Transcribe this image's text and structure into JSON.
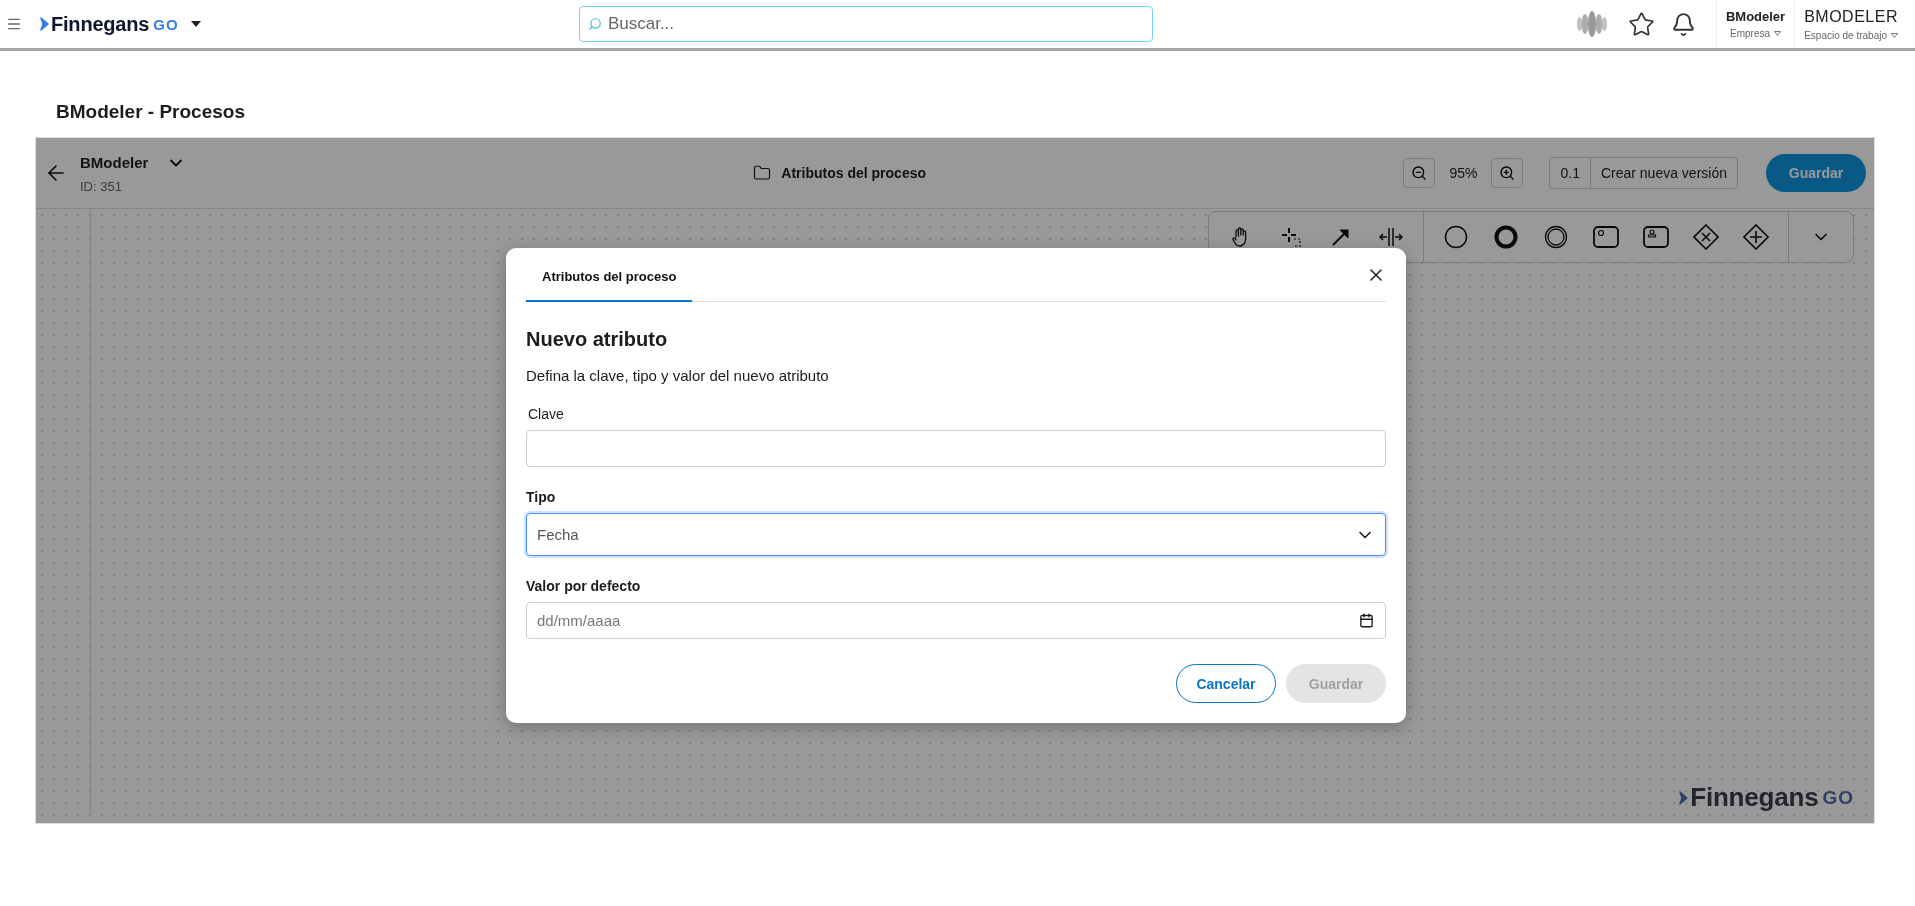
{
  "topbar": {
    "logo": {
      "name": "Finnegans",
      "suffix": "GO"
    },
    "search": {
      "placeholder": "Buscar..."
    },
    "company": {
      "value": "BModeler",
      "label": "Empresa"
    },
    "workspace": {
      "value": "BMODELER",
      "label": "Espacio de trabajo"
    }
  },
  "page_title": "BModeler - Procesos",
  "editor": {
    "process_name": "BModeler",
    "process_id": "ID: 351",
    "section": "Atributos del proceso",
    "zoom": "95%",
    "version": "0.1",
    "new_version": "Crear nueva versión",
    "save": "Guardar",
    "tools": [
      {
        "kind": "hand"
      },
      {
        "kind": "lasso"
      },
      {
        "kind": "connect"
      },
      {
        "kind": "space"
      },
      {
        "kind": "start"
      },
      {
        "kind": "end"
      },
      {
        "kind": "intermediate"
      },
      {
        "kind": "service"
      },
      {
        "kind": "user"
      },
      {
        "kind": "xor"
      },
      {
        "kind": "parallel"
      }
    ],
    "watermark": {
      "name": "Finnegans",
      "suffix": "GO"
    }
  },
  "dialog": {
    "tabs": [
      {
        "label": "Atributos del proceso",
        "selected": true
      }
    ],
    "title": "Nuevo atributo",
    "description": "Defina la clave, tipo y valor del nuevo atributo",
    "fields": [
      {
        "kind": "text",
        "label": "Clave",
        "focused": false
      },
      {
        "kind": "select",
        "label": "Tipo",
        "value": "Fecha",
        "focused": true
      },
      {
        "kind": "date",
        "label": "Valor por defecto",
        "placeholder": "dd/mm/aaaa",
        "focused": false
      }
    ],
    "buttons": [
      {
        "label": "Cancelar",
        "disabled": false
      },
      {
        "label": "Guardar",
        "disabled": true
      }
    ]
  }
}
